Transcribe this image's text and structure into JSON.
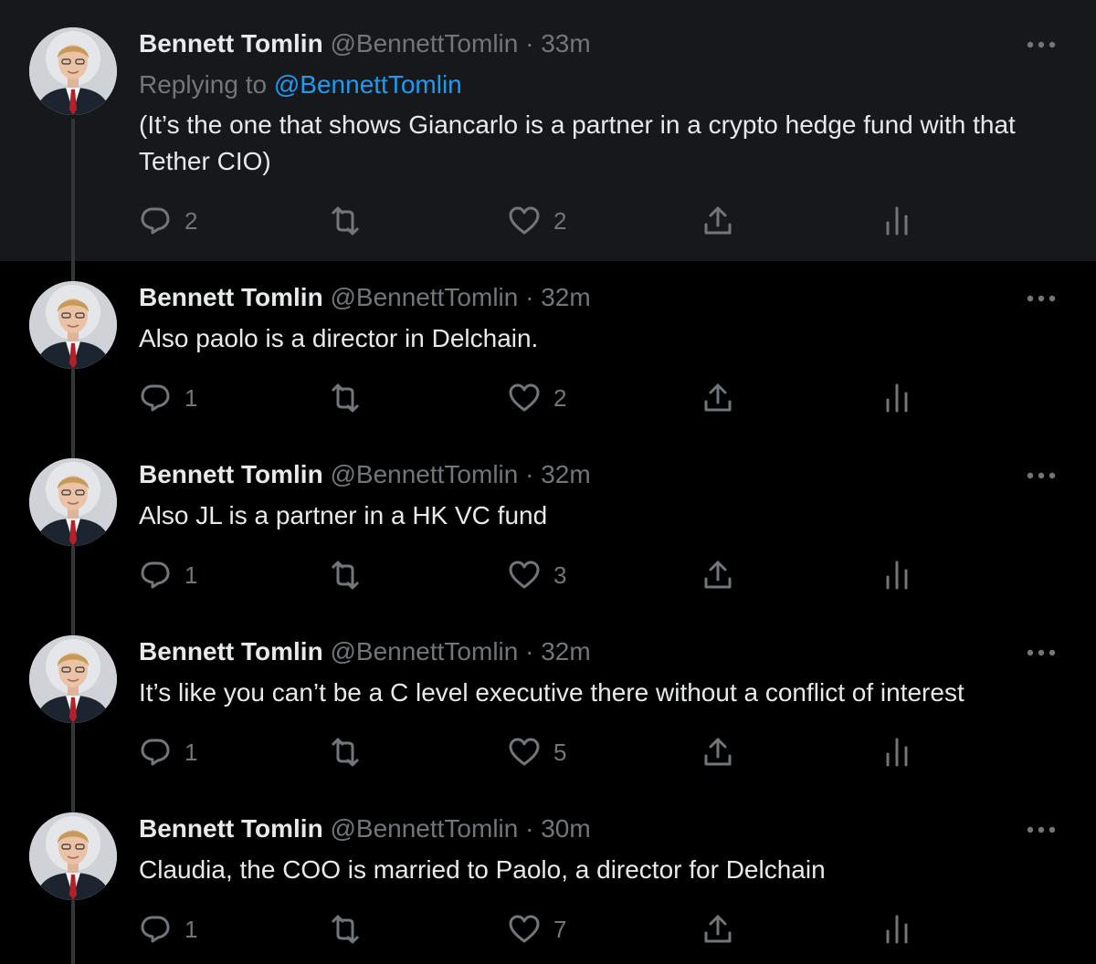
{
  "author": {
    "display_name": "Bennett Tomlin",
    "handle": "@BennettTomlin"
  },
  "reply_context": {
    "prefix": "Replying to",
    "mention": "@BennettTomlin"
  },
  "icons": {
    "more": "more-horizontal-icon",
    "reply": "reply-bubble-icon",
    "retweet": "retweet-arrows-icon",
    "like": "heart-icon",
    "share": "share-upload-icon",
    "analytics": "analytics-bars-icon"
  },
  "colors": {
    "background": "#000000",
    "highlight_background": "#16181c",
    "text": "#e7e9ea",
    "secondary": "#71767b",
    "link": "#1d9bf0",
    "thread_line": "#333639"
  },
  "separator": "·",
  "tweets": [
    {
      "timestamp": "33m",
      "text": "(It’s the one that shows Giancarlo is a partner in a crypto hedge fund with that Tether CIO)",
      "reply_count": "2",
      "like_count": "2"
    },
    {
      "timestamp": "32m",
      "text": "Also paolo is a director in Delchain.",
      "reply_count": "1",
      "like_count": "2"
    },
    {
      "timestamp": "32m",
      "text": "Also JL is a partner in a HK VC fund",
      "reply_count": "1",
      "like_count": "3"
    },
    {
      "timestamp": "32m",
      "text": "It’s like you can’t be a C level executive there without a conflict of interest",
      "reply_count": "1",
      "like_count": "5"
    },
    {
      "timestamp": "30m",
      "text": "Claudia, the COO is married to Paolo, a director for Delchain",
      "reply_count": "1",
      "like_count": "7"
    }
  ]
}
